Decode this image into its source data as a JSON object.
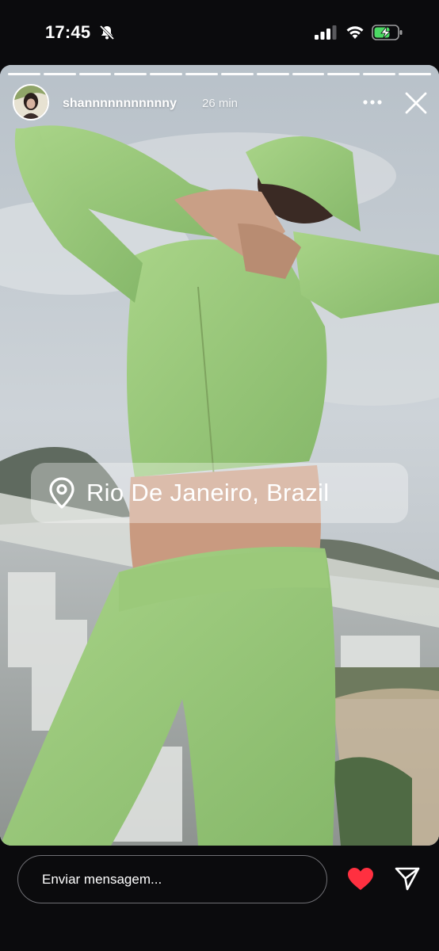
{
  "status_bar": {
    "time": "17:45",
    "icons": [
      "bell-slash-icon",
      "cellular-signal-icon",
      "wifi-icon",
      "battery-charging-icon"
    ]
  },
  "story": {
    "username": "shannnnnnnnnnny",
    "time_ago": "26 min",
    "progress_segments": 12,
    "active_segments": 12,
    "location_sticker": {
      "icon": "location-pin-icon",
      "text": "Rio De Janeiro, Brazil"
    },
    "icons": [
      "more-options-icon",
      "close-icon"
    ]
  },
  "bottom_bar": {
    "message_placeholder": "Enviar mensagem...",
    "icons": [
      "heart-icon",
      "send-icon"
    ],
    "heart_color": "#ff3040"
  }
}
